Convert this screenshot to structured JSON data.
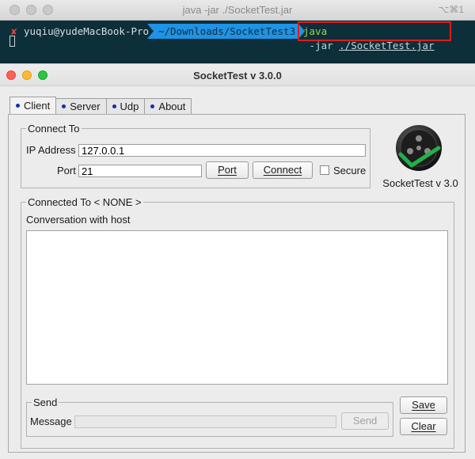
{
  "terminal": {
    "title": "java -jar ./SocketTest.jar",
    "shortcut": "⌥⌘1",
    "prompt_status_icon": "x-icon",
    "prompt_user": "yuqiu@yudeMacBook-Pro",
    "prompt_path": "~/Downloads/SocketTest3",
    "command_java": "java",
    "command_flag": " -jar ",
    "command_file": "./SocketTest.jar"
  },
  "app": {
    "title": "SocketTest v 3.0.0",
    "tabs": [
      {
        "label": "Client",
        "active": true
      },
      {
        "label": "Server",
        "active": false
      },
      {
        "label": "Udp",
        "active": false
      },
      {
        "label": "About",
        "active": false
      }
    ],
    "connect_to": {
      "legend": "Connect To",
      "ip_label": "IP Address",
      "ip_value": "127.0.0.1",
      "port_label": "Port",
      "port_value": "21",
      "port_button": "Port",
      "connect_button": "Connect",
      "secure_label": "Secure",
      "secure_checked": false
    },
    "logo_caption": "SocketTest v 3.0",
    "connected": {
      "legend": "Connected To < NONE >",
      "conversation_label": "Conversation with host",
      "conversation_text": ""
    },
    "send": {
      "legend": "Send",
      "message_label": "Message",
      "message_value": "",
      "send_button": "Send"
    },
    "save_button": "Save",
    "clear_button": "Clear",
    "colors": {
      "terminal_bg": "#0c2f3a",
      "path_segment": "#1f93e5",
      "highlight_box": "#e21b1b",
      "logo_check": "#22b14c"
    }
  }
}
